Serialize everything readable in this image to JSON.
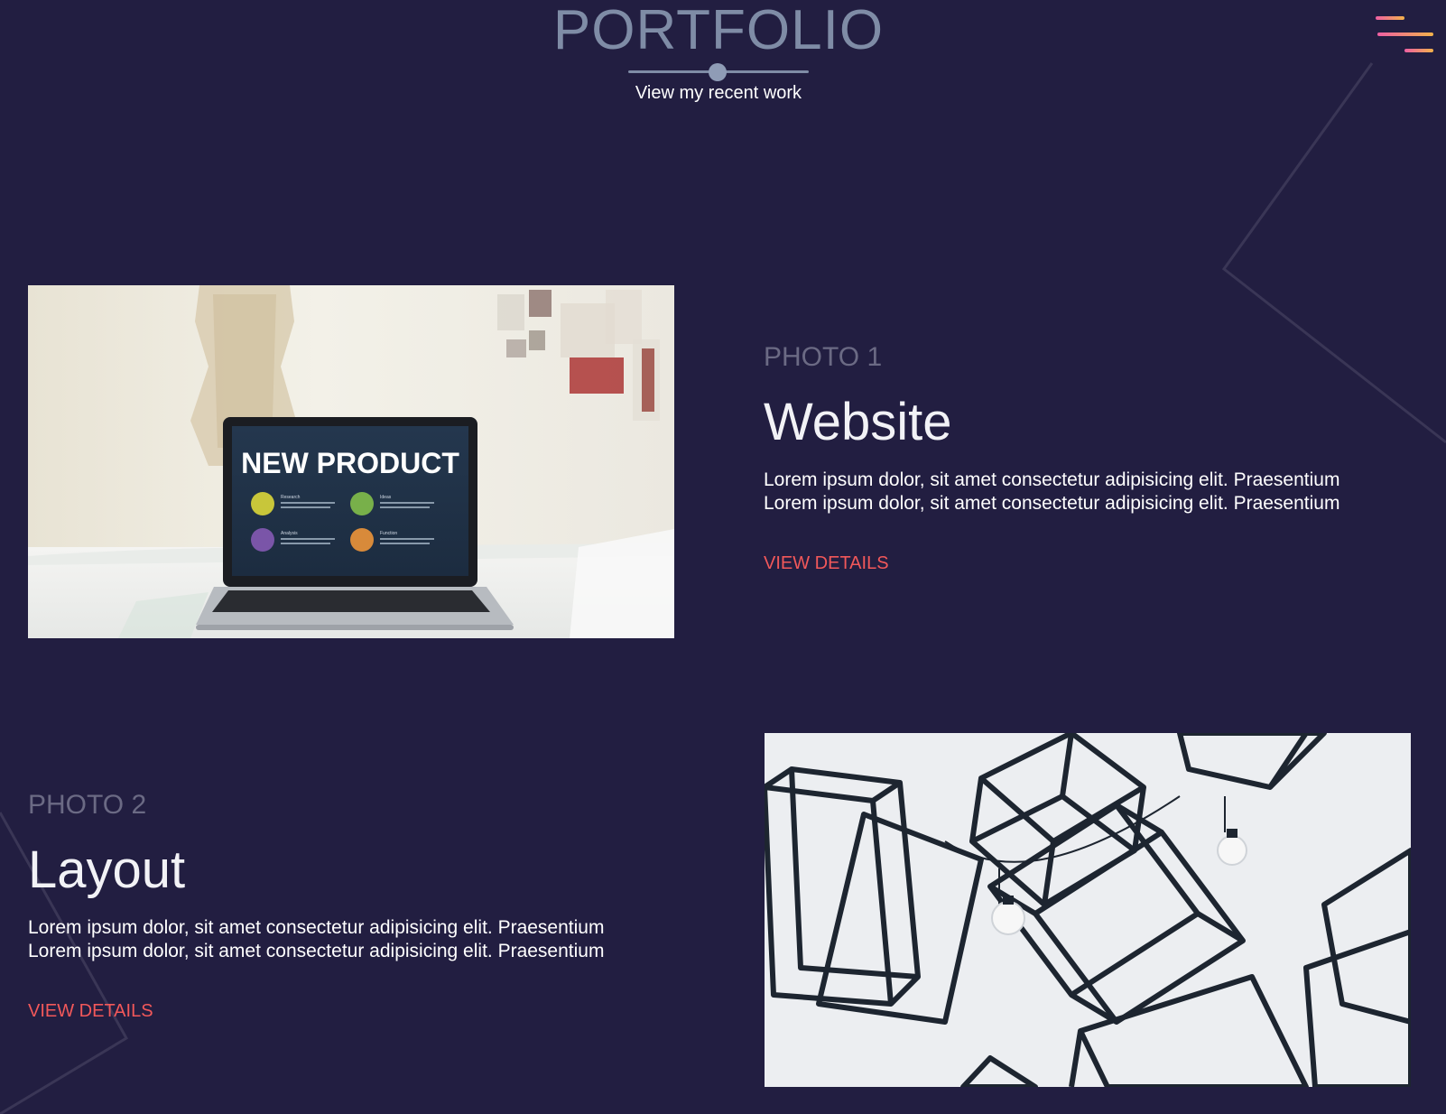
{
  "header": {
    "title": "PORTFOLIO",
    "subtitle": "View my recent work"
  },
  "menu": {
    "icon": "hamburger-menu-icon",
    "gradient": [
      "#ee5fa3",
      "#f2b24a"
    ]
  },
  "colors": {
    "background": "#221e41",
    "title": "#7f8ca6",
    "photo_label": "#6b6a84",
    "link": "#f2585a"
  },
  "projects": [
    {
      "photo_label": "PHOTO 1",
      "title": "Website",
      "description": [
        "Lorem ipsum dolor, sit amet consectetur adipisicing elit. Praesentium",
        "Lorem ipsum dolor, sit amet consectetur adipisicing elit. Praesentium"
      ],
      "link": "VIEW DETAILS",
      "image": {
        "subject": "laptop on desk",
        "screen_heading": "NEW PRODUCT",
        "screen_items": [
          "Research",
          "Ideas",
          "Analysis",
          "Function"
        ]
      }
    },
    {
      "photo_label": "PHOTO 2",
      "title": "Layout",
      "description": [
        "Lorem ipsum dolor, sit amet consectetur adipisicing elit. Praesentium",
        "Lorem ipsum dolor, sit amet consectetur adipisicing elit. Praesentium"
      ],
      "link": "VIEW DETAILS",
      "image": {
        "subject": "hanging wire cube lamps"
      }
    }
  ]
}
